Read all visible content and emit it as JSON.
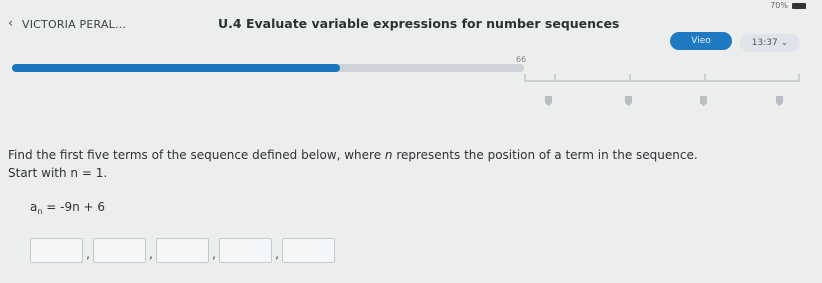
{
  "status": {
    "battery": "70%"
  },
  "header": {
    "back": "‹",
    "student": "VICTORIA PERAL...",
    "lesson": "U.4 Evaluate variable expressions for number sequences",
    "level_label": "Vieo",
    "timer": "13:37"
  },
  "progress": {
    "score": "66",
    "fraction": 0.64
  },
  "problem": {
    "instruction_a": "Find the first five terms of the sequence defined below, where ",
    "variable": "n",
    "instruction_b": " represents the position of a term in the sequence.",
    "start_label": "Start with ",
    "start_value": "n = 1.",
    "formula_base": "a",
    "formula_sub": "n",
    "formula_rhs": " = -9n + 6"
  },
  "answers": {
    "count": 5,
    "separator": ","
  }
}
